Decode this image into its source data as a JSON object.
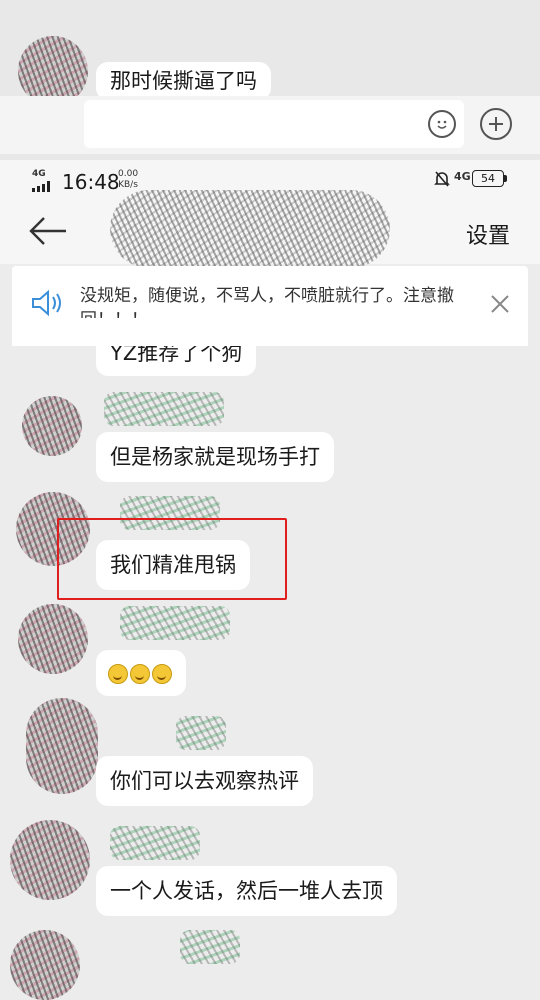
{
  "previous_screen": {
    "message_text": "那时候撕逼了吗"
  },
  "status_bar": {
    "network": "4G",
    "time": "16:48",
    "speed_value": "0.00",
    "speed_unit": "KB/s",
    "network_right": "4G",
    "battery": "54"
  },
  "header": {
    "back_icon": "arrow-left-icon",
    "settings_label": "设置"
  },
  "notice": {
    "icon": "speaker-icon",
    "text": "没规矩，随便说，不骂人，不喷脏就行了。注意撤回！！！",
    "close_icon": "close-icon"
  },
  "messages": [
    {
      "text": "YZ推荐了个狗"
    },
    {
      "text": "但是杨家就是现场手打"
    },
    {
      "text": "我们精准甩锅"
    },
    {
      "text": "",
      "emoji_count": 3
    },
    {
      "text": "你们可以去观察热评"
    },
    {
      "text": "一个人发话，然后一堆人去顶"
    }
  ],
  "colors": {
    "highlight_box": "#e01e1e",
    "bubble": "#ffffff",
    "chat_background": "#ececec"
  }
}
